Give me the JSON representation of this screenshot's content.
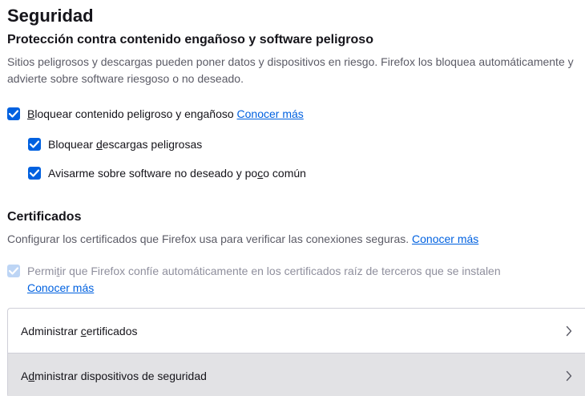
{
  "security": {
    "title": "Seguridad"
  },
  "deceptive": {
    "heading": "Protección contra contenido engañoso y software peligroso",
    "description": "Sitios peligrosos y descargas pueden poner datos y dispositivos en riesgo. Firefox los bloquea automáticamente y advierte sobre software riesgoso o no deseado.",
    "block_dangerous": {
      "label_before": "",
      "label_key": "B",
      "label_after": "loquear contenido peligroso y engañoso",
      "link": "Conocer más",
      "checked": true
    },
    "block_downloads": {
      "label_before": "Bloquear ",
      "label_key": "d",
      "label_after": "escargas peligrosas",
      "checked": true
    },
    "warn_unwanted": {
      "label_before": "Avisarme sobre software no deseado y po",
      "label_key": "c",
      "label_after": "o común",
      "checked": true
    }
  },
  "certificates": {
    "heading": "Certificados",
    "description": "Configurar los certificados que Firefox usa para verificar las conexiones seguras.",
    "description_link": "Conocer más",
    "third_party_roots": {
      "label_before": "Permi",
      "label_key": "t",
      "label_after": "ir que Firefox confíe automáticamente en los certificados raíz de terceros que se instalen",
      "link": "Conocer más",
      "checked": true,
      "disabled": true
    },
    "manage_certificates": {
      "label_before": "Administrar ",
      "label_key": "c",
      "label_after": "ertificados"
    },
    "manage_devices": {
      "label_before": "A",
      "label_key": "d",
      "label_after": "ministrar dispositivos de seguridad"
    }
  },
  "colors": {
    "accent": "#0061e0",
    "text": "#15141a",
    "muted": "#5b5b66",
    "hover_row": "#e2e2e5"
  }
}
